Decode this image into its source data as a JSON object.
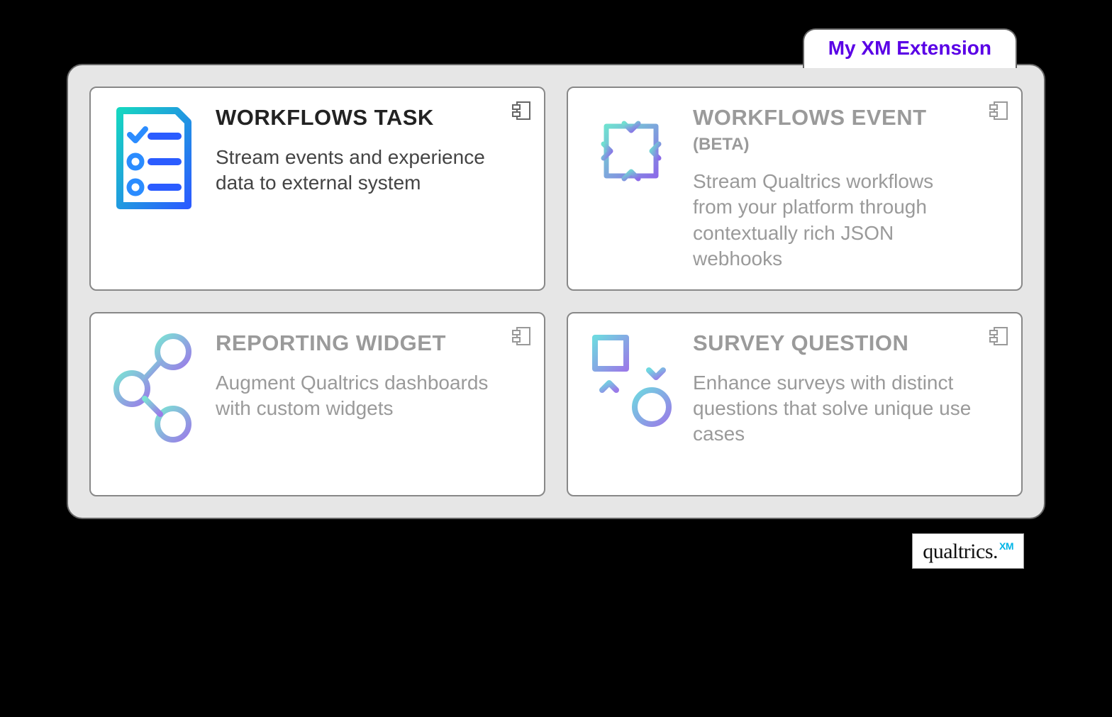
{
  "tab_label": "My XM Extension",
  "cards": {
    "workflows_task": {
      "title": "WORKFLOWS TASK",
      "description": "Stream events and experience data to external system"
    },
    "workflows_event": {
      "title": "WORKFLOWS EVENT",
      "subtitle": "(BETA)",
      "description": "Stream Qualtrics workflows from your platform through contextually rich JSON webhooks"
    },
    "reporting_widget": {
      "title": "REPORTING WIDGET",
      "description": "Augment Qualtrics dashboards with custom widgets"
    },
    "survey_question": {
      "title": "SURVEY QUESTION",
      "description": "Enhance surveys with distinct questions that solve unique use cases"
    }
  },
  "logo": {
    "text": "qualtrics.",
    "badge": "XM"
  }
}
